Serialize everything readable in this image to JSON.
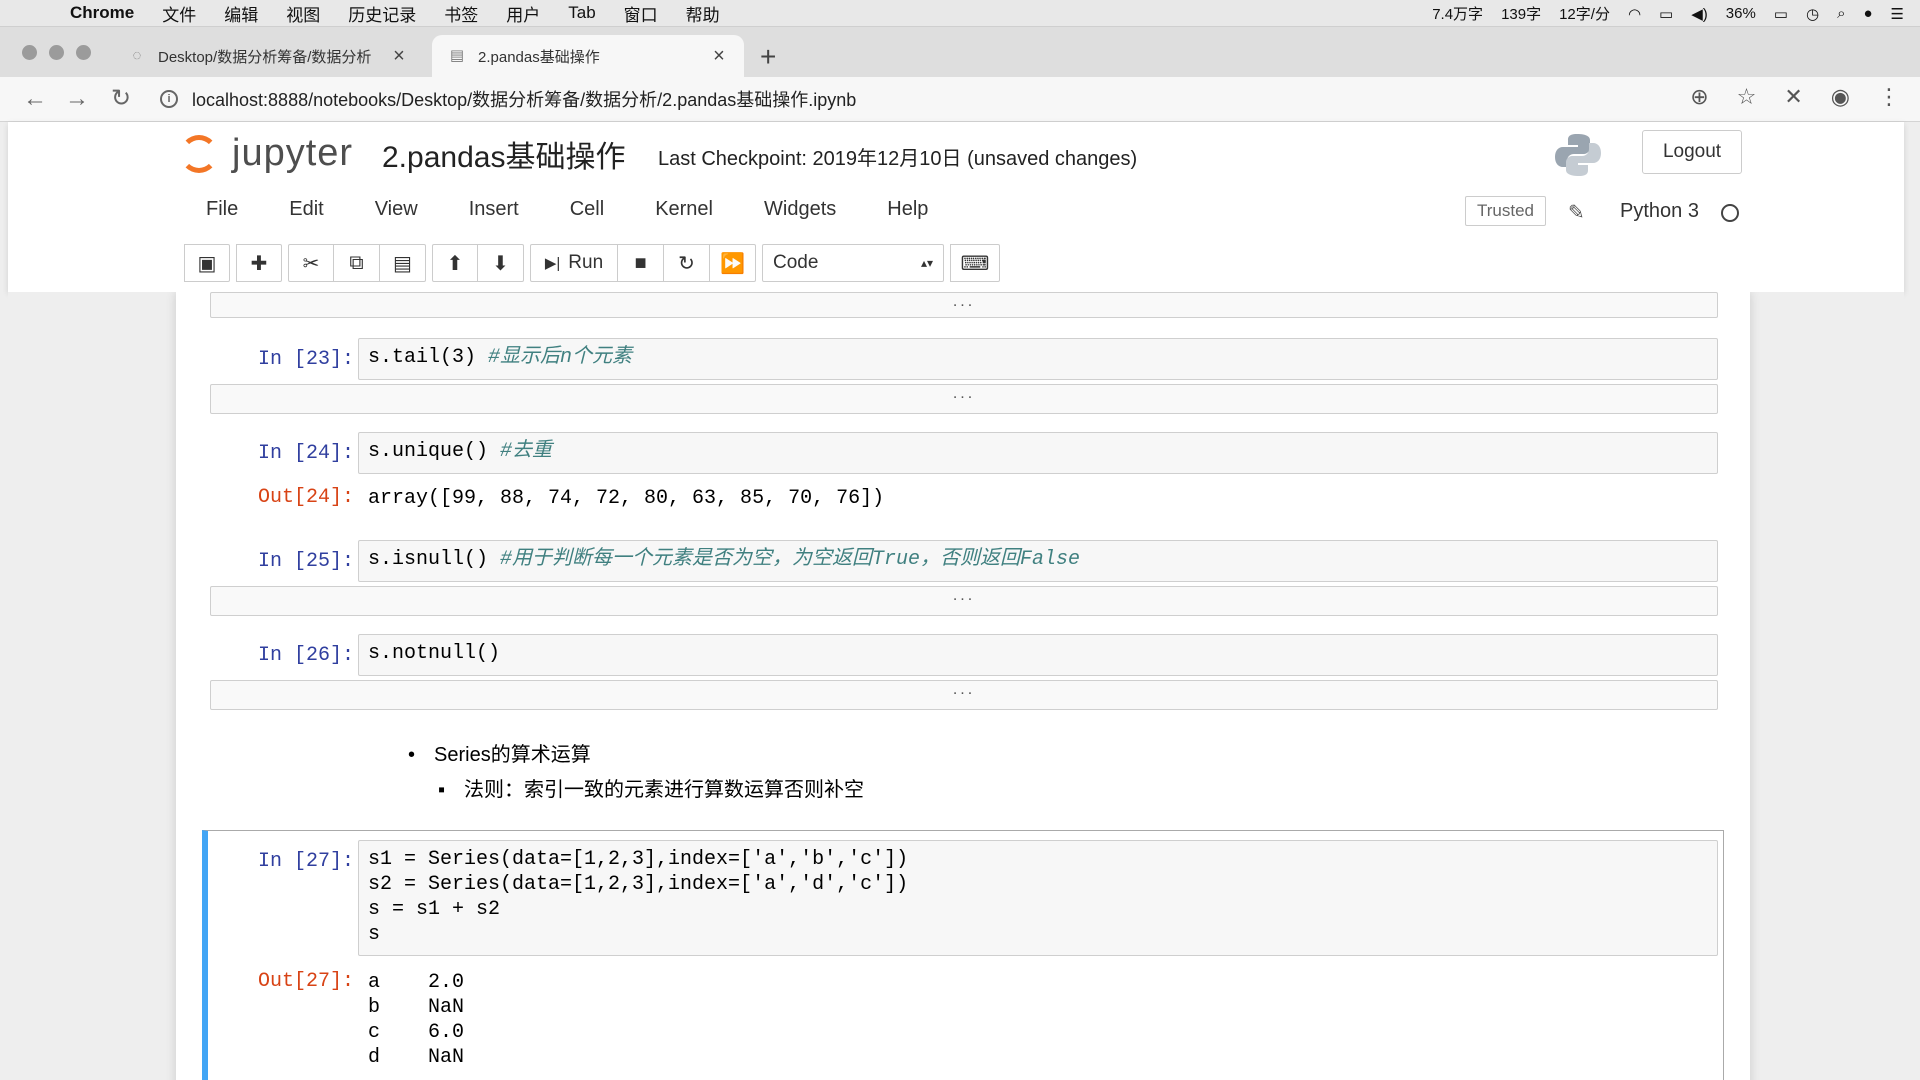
{
  "menubar": {
    "apple": "",
    "items": [
      "Chrome",
      "文件",
      "编辑",
      "视图",
      "历史记录",
      "书签",
      "用户",
      "Tab",
      "窗口",
      "帮助"
    ],
    "status": [
      "7.4万字",
      "139字",
      "12字/分",
      "36%"
    ]
  },
  "tabs": [
    {
      "label": "Desktop/数据分析筹备/数据分析"
    },
    {
      "label": "2.pandas基础操作"
    }
  ],
  "url": "localhost:8888/notebooks/Desktop/数据分析筹备/数据分析/2.pandas基础操作.ipynb",
  "jupyter": {
    "logo_text": "jupyter",
    "notebook_title": "2.pandas基础操作",
    "checkpoint": "Last Checkpoint: 2019年12月10日   (unsaved changes)",
    "logout": "Logout",
    "menu": [
      "File",
      "Edit",
      "View",
      "Insert",
      "Cell",
      "Kernel",
      "Widgets",
      "Help"
    ],
    "trusted": "Trusted",
    "kernel": "Python 3",
    "run_label": "Run",
    "cell_type": "Code"
  },
  "cells": {
    "c23": {
      "prompt": "In [23]:",
      "code": "s.tail(3) ",
      "comment": "#显示后n个元素",
      "out": "..."
    },
    "c24": {
      "prompt": "In [24]:",
      "code": "s.unique() ",
      "comment": "#去重",
      "out_prompt": "Out[24]:",
      "out": "array([99, 88, 74, 72, 80, 63, 85, 70, 76])"
    },
    "c25": {
      "prompt": "In [25]:",
      "code": "s.isnull() ",
      "comment": "#用于判断每一个元素是否为空，为空返回True，否则返回False",
      "out": "..."
    },
    "c26": {
      "prompt": "In [26]:",
      "code": "s.notnull()",
      "out": "..."
    },
    "md": {
      "li1": "Series的算术运算",
      "li2": "法则：索引一致的元素进行算数运算否则补空"
    },
    "c27": {
      "prompt": "In [27]:",
      "code": "s1 = Series(data=[1,2,3],index=['a','b','c'])\ns2 = Series(data=[1,2,3],index=['a','d','c'])\ns = s1 + s2\ns",
      "out_prompt": "Out[27]:",
      "out": "a    2.0\nb    NaN\nc    6.0\nd    NaN"
    },
    "top_collapsed": "..."
  }
}
